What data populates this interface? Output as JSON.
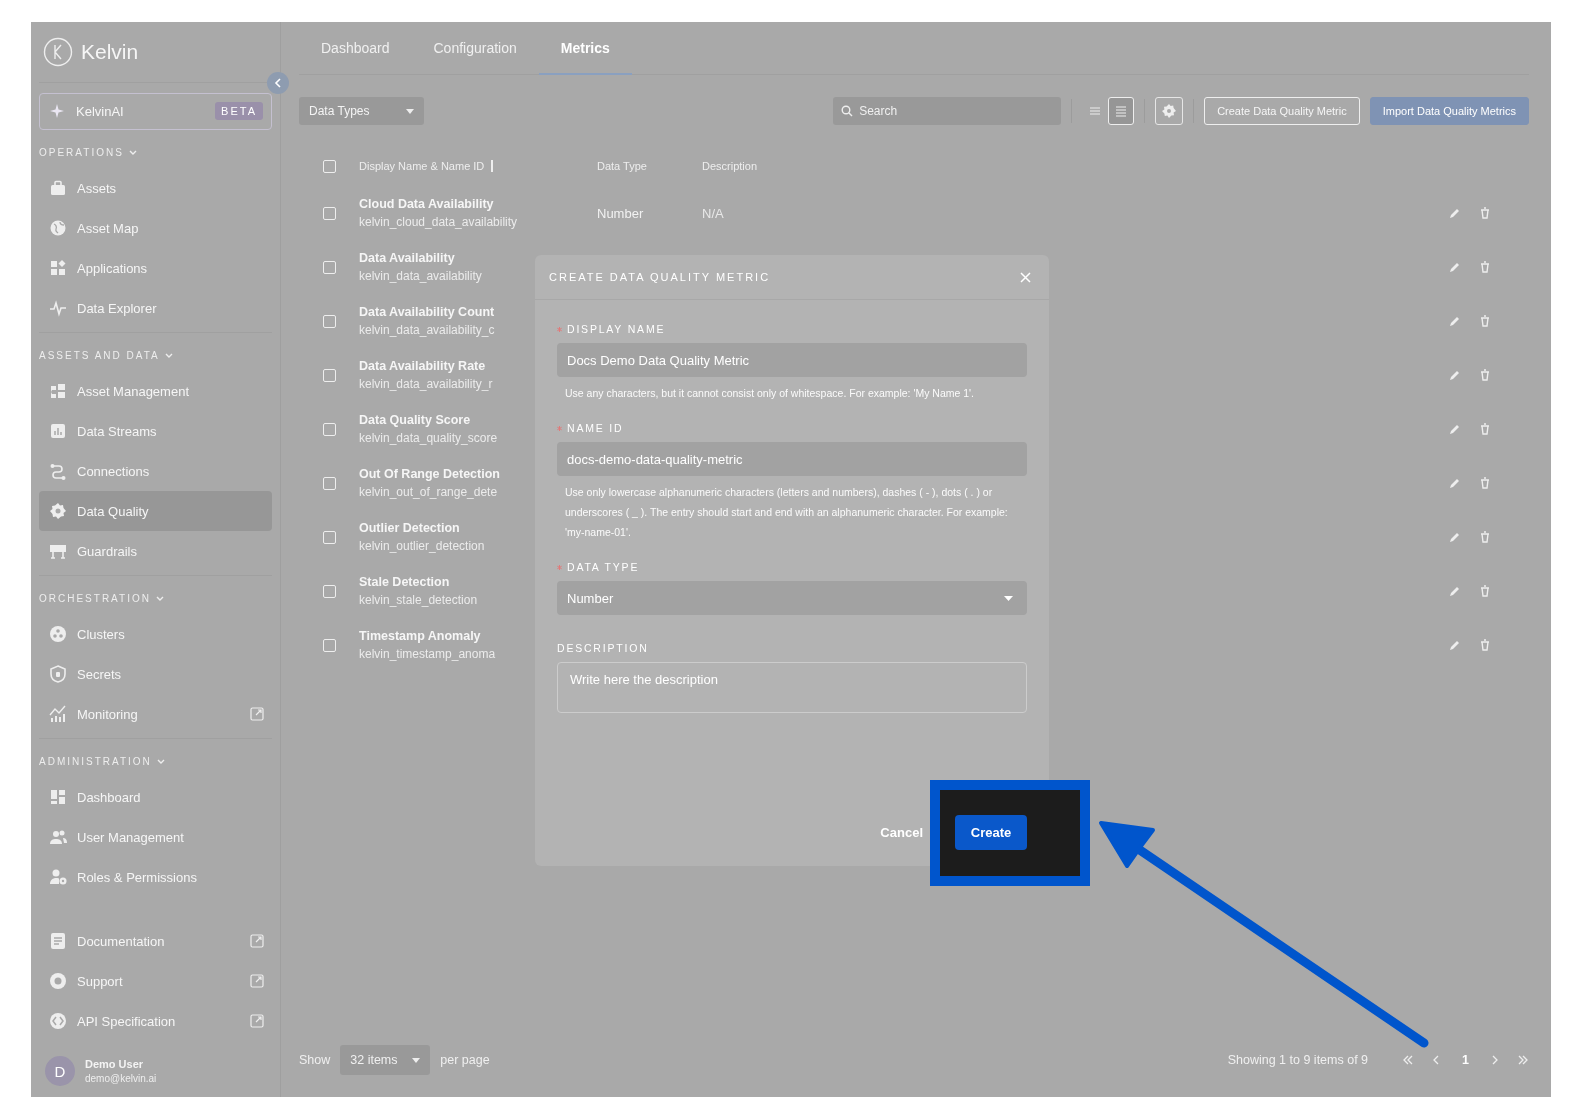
{
  "sidebar": {
    "logo": "Kelvin",
    "ai_item": {
      "label": "KelvinAI",
      "badge": "BETA"
    },
    "sections": [
      {
        "title": "OPERATIONS",
        "expanded": true,
        "items": [
          {
            "label": "Assets",
            "selected": false,
            "external": false
          },
          {
            "label": "Asset Map",
            "selected": false,
            "external": false
          },
          {
            "label": "Applications",
            "selected": false,
            "external": false
          },
          {
            "label": "Data Explorer",
            "selected": false,
            "external": false
          }
        ]
      },
      {
        "title": "ASSETS AND DATA",
        "expanded": true,
        "items": [
          {
            "label": "Asset Management",
            "selected": false,
            "external": false
          },
          {
            "label": "Data Streams",
            "selected": false,
            "external": false
          },
          {
            "label": "Connections",
            "selected": false,
            "external": false
          },
          {
            "label": "Data Quality",
            "selected": true,
            "external": false
          },
          {
            "label": "Guardrails",
            "selected": false,
            "external": false
          }
        ]
      },
      {
        "title": "ORCHESTRATION",
        "expanded": true,
        "items": [
          {
            "label": "Clusters",
            "selected": false,
            "external": false
          },
          {
            "label": "Secrets",
            "selected": false,
            "external": false
          },
          {
            "label": "Monitoring",
            "selected": false,
            "external": true
          }
        ]
      },
      {
        "title": "ADMINISTRATION",
        "expanded": true,
        "items": [
          {
            "label": "Dashboard",
            "selected": false,
            "external": false
          },
          {
            "label": "User Management",
            "selected": false,
            "external": false
          },
          {
            "label": "Roles & Permissions",
            "selected": false,
            "external": false
          }
        ]
      },
      {
        "items": [
          {
            "label": "Documentation",
            "selected": false,
            "external": true
          },
          {
            "label": "Support",
            "selected": false,
            "external": true
          },
          {
            "label": "API Specification",
            "selected": false,
            "external": true
          }
        ]
      }
    ],
    "user": {
      "initial": "D",
      "name": "Demo User",
      "email": "demo@kelvin.ai"
    }
  },
  "tabs": [
    {
      "label": "Dashboard",
      "selected": false
    },
    {
      "label": "Configuration",
      "selected": false
    },
    {
      "label": "Metrics",
      "selected": true
    }
  ],
  "toolbar": {
    "filter": "Data Types",
    "search": {
      "placeholder": "Search"
    },
    "view_toggle": [
      {
        "selected": false
      },
      {
        "selected": true
      }
    ],
    "buttons": [
      {
        "label": "Create Data Quality Metric",
        "kind": "outline"
      },
      {
        "label": "Import Data Quality Metrics",
        "kind": "primary"
      }
    ]
  },
  "table": {
    "columns": [
      "Display Name & Name ID",
      "Data Type",
      "Description"
    ],
    "header_checked": false,
    "rows": [
      {
        "name": "Cloud Data Availability",
        "name_id": "kelvin_cloud_data_availability",
        "data_type": "Number",
        "description": "N/A",
        "checked": false
      },
      {
        "name": "Data Availability",
        "name_id": "kelvin_data_availability",
        "checked": false
      },
      {
        "name": "Data Availability Count",
        "name_id": "kelvin_data_availability_c",
        "checked": false
      },
      {
        "name": "Data Availability Rate",
        "name_id": "kelvin_data_availability_r",
        "checked": false
      },
      {
        "name": "Data Quality Score",
        "name_id": "kelvin_data_quality_score",
        "checked": false
      },
      {
        "name": "Out Of Range Detection",
        "name_id": "kelvin_out_of_range_dete",
        "checked": false
      },
      {
        "name": "Outlier Detection",
        "name_id": "kelvin_outlier_detection",
        "checked": false
      },
      {
        "name": "Stale Detection",
        "name_id": "kelvin_stale_detection",
        "checked": false
      },
      {
        "name": "Timestamp Anomaly",
        "name_id": "kelvin_timestamp_anoma",
        "checked": false
      }
    ]
  },
  "footer": {
    "show_label": "Show",
    "page_size": "32 items",
    "per_page_label": "per page",
    "summary": "Showing 1 to 9 items of 9",
    "pages": [
      {
        "label": "1",
        "selected": true
      }
    ]
  },
  "modal": {
    "title": "CREATE DATA QUALITY METRIC",
    "fields": [
      {
        "kind": "text",
        "label": "DISPLAY NAME",
        "required": true,
        "value": "Docs Demo Data Quality Metric",
        "help": "Use any characters, but it cannot consist only of whitespace. For example: 'My Name 1'."
      },
      {
        "kind": "text",
        "label": "NAME ID",
        "required": true,
        "value": "docs-demo-data-quality-metric",
        "help": "Use only lowercase alphanumeric characters (letters and numbers), dashes ( - ), dots ( . ) or underscores ( _ ). The entry should start and end with an alphanumeric character. For example: 'my-name-01'."
      },
      {
        "kind": "select",
        "label": "DATA TYPE",
        "required": true,
        "value": "Number"
      },
      {
        "kind": "textarea",
        "label": "DESCRIPTION",
        "required": false,
        "placeholder": "Write here the description"
      }
    ],
    "cancel": "Cancel",
    "submit": "Create"
  }
}
